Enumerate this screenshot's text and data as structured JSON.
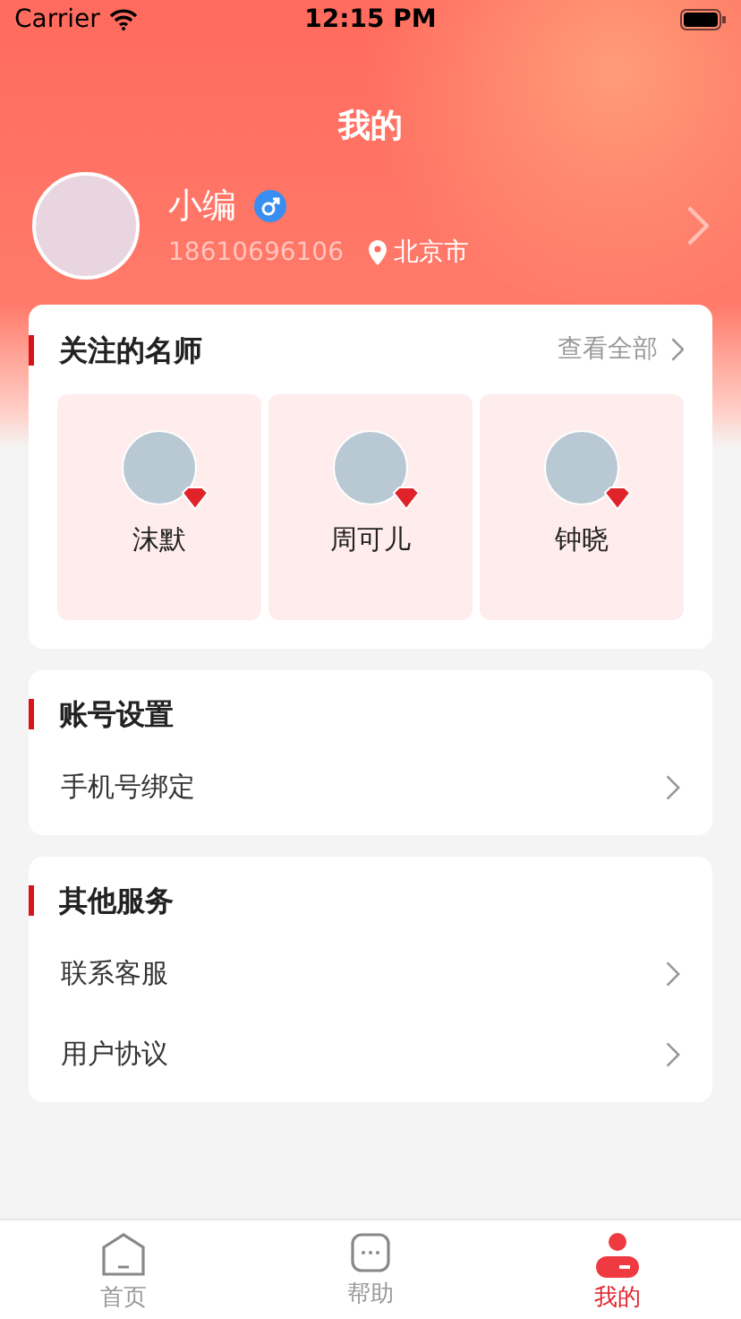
{
  "status_bar": {
    "carrier": "Carrier",
    "time": "12:15 PM"
  },
  "header": {
    "title": "我的"
  },
  "profile": {
    "name": "小编",
    "phone": "18610696106",
    "city": "北京市"
  },
  "teachers": {
    "title": "关注的名师",
    "more": "查看全部",
    "items": [
      {
        "name": "沫默"
      },
      {
        "name": "周可儿"
      },
      {
        "name": "钟晓"
      }
    ]
  },
  "sections": [
    {
      "title": "账号设置",
      "rows": [
        "手机号绑定"
      ]
    },
    {
      "title": "其他服务",
      "rows": [
        "联系客服",
        "用户协议"
      ]
    }
  ],
  "tab_bar": [
    {
      "label": "首页",
      "kind": "home",
      "selected": false
    },
    {
      "label": "帮助",
      "kind": "help",
      "selected": false
    },
    {
      "label": "我的",
      "kind": "me",
      "selected": true
    }
  ]
}
